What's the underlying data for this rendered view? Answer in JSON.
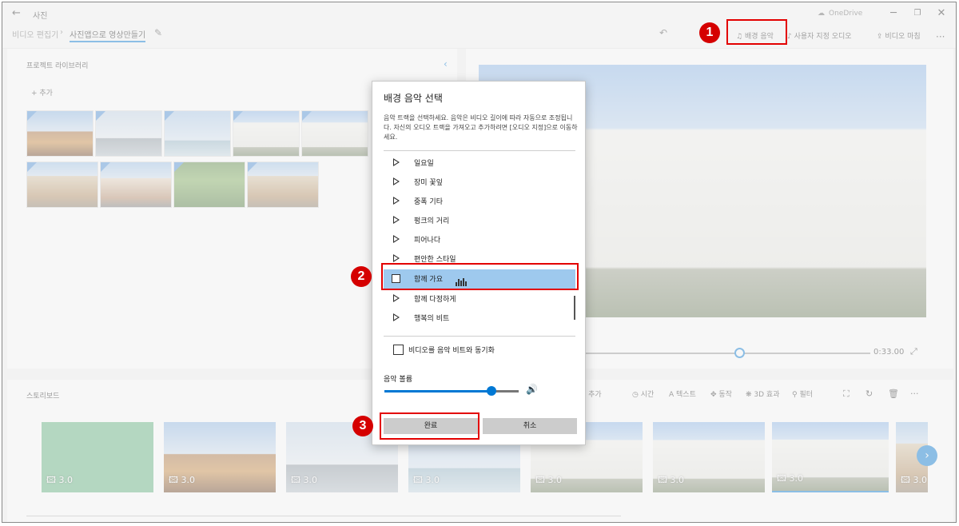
{
  "window": {
    "title": "사진",
    "onedrive": "OneDrive"
  },
  "toolbar": {
    "crumb_root": "비디오 편집기",
    "crumb_current": "사진앱으로 영상만들기",
    "bg_music": "배경 음악",
    "custom_audio": "사용자 지정 오디오",
    "finish_video": "비디오 마침"
  },
  "library": {
    "title": "프로젝트 라이브러리",
    "add": "추가"
  },
  "preview": {
    "time": "0:33.00"
  },
  "storyboard": {
    "title": "스토리보드",
    "tools": [
      "드 추가",
      "시간",
      "텍스트",
      "동작",
      "3D 효과",
      "필터"
    ],
    "clips": [
      {
        "duration": "3.0"
      },
      {
        "duration": "3.0"
      },
      {
        "duration": "3.0"
      },
      {
        "duration": "3.0"
      },
      {
        "duration": "3.0"
      },
      {
        "duration": "3.0"
      },
      {
        "duration": "3.0"
      },
      {
        "duration": "3.0"
      }
    ]
  },
  "dialog": {
    "title": "배경 음악 선택",
    "description": "음악 트랙을 선택하세요. 음악은 비디오 길이에 따라 자동으로 조정됩니다. 자신의 오디오 트랙을 가져오고 추가하려면 [오디오 지정]으로 이동하세요.",
    "tracks": [
      "일요일",
      "장미 꽃잎",
      "중폭 기타",
      "펑크의 거리",
      "피어나다",
      "편안한 스타일",
      "함께 가요",
      "함께 다정하게",
      "행복의 비트"
    ],
    "selected_track": "함께 가요",
    "sync_label": "비디오를 음악 비트와 동기화",
    "sync_checked": false,
    "volume_label": "음악 볼륨",
    "volume": 0.8,
    "done": "완료",
    "cancel": "취소"
  },
  "annotations": [
    "1",
    "2",
    "3"
  ],
  "colors": {
    "accent": "#0078d4",
    "selection": "#9ec9ee",
    "annotation": "#d50000"
  }
}
